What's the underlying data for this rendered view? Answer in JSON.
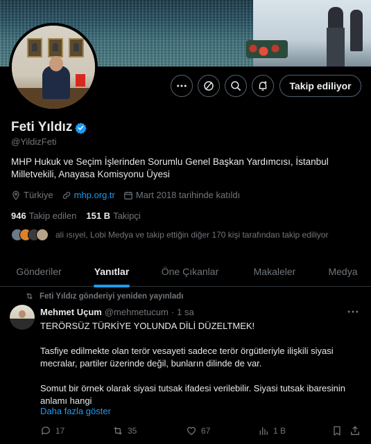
{
  "profile": {
    "name": "Feti Yıldız",
    "handle": "@YildizFeti",
    "bio": "MHP Hukuk ve Seçim İşlerinden Sorumlu Genel Başkan Yardımcısı, İstanbul Milletvekili, Anayasa Komisyonu Üyesi",
    "location": "Türkiye",
    "website": "mhp.org.tr",
    "joined": "Mart 2018 tarihinde katıldı",
    "following_count": "946",
    "following_label": "Takip edilen",
    "followers_count": "151 B",
    "followers_label": "Takipçi",
    "followers_you_know": "ali ısıyel, Lobi Medya ve takip ettiğin diğer 170 kişi tarafından takip ediliyor"
  },
  "actions": {
    "follow_label": "Takip ediliyor"
  },
  "tabs": [
    {
      "label": "Gönderiler",
      "active": false
    },
    {
      "label": "Yanıtlar",
      "active": true
    },
    {
      "label": "Öne Çıkanlar",
      "active": false
    },
    {
      "label": "Makaleler",
      "active": false
    },
    {
      "label": "Medya",
      "active": false
    }
  ],
  "tweet": {
    "repost_label": "Feti Yıldız gönderiyi yeniden yayınladı",
    "author_name": "Mehmet Uçum",
    "author_handle": "@mehmetucum",
    "separator": "·",
    "time": "1 sa",
    "paragraphs": [
      "TERÖRSÜZ TÜRKİYE YOLUNDA DİLİ DÜZELTMEK!",
      "Tasfiye edilmekte olan terör vesayeti sadece terör örgütleriyle ilişkili siyasi mecralar, partiler üzerinde değil, bunların dilinde de var.",
      "Somut bir örnek olarak siyasi tutsak ifadesi verilebilir. Siyasi tutsak ibaresinin anlamı hangi"
    ],
    "show_more": "Daha fazla göster",
    "replies": "17",
    "reposts": "35",
    "likes": "67",
    "views": "1 B"
  },
  "colors": {
    "accent": "#1d9bf0",
    "verified": "#1d9bf0",
    "muted": "#71767b",
    "border": "#2f3336"
  }
}
